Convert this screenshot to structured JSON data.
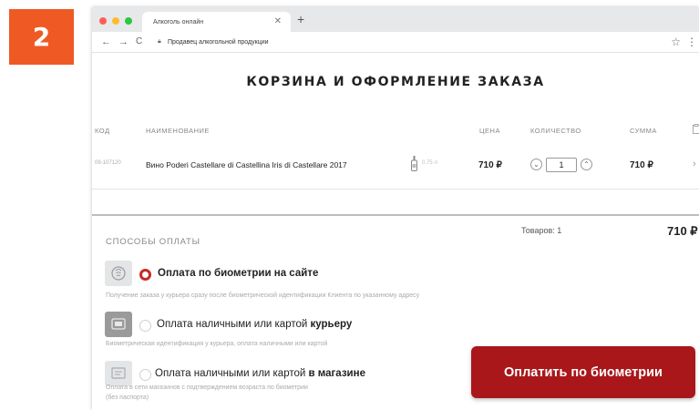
{
  "step_number": "2",
  "browser": {
    "tab_title": "Алкоголь онлайн",
    "address": "Продавец алкогольной продукции",
    "icons": [
      "close-icon",
      "plus-icon",
      "back-arrow-icon",
      "forward-arrow-icon",
      "reload-icon",
      "lock-icon",
      "star-icon",
      "more-vertical-icon"
    ]
  },
  "page": {
    "title": "КОРЗИНА И ОФОРМЛЕНИЕ ЗАКАЗА",
    "columns": {
      "code": "КОД",
      "name": "НАИМЕНОВАНИЕ",
      "price": "ЦЕНА",
      "quantity": "КОЛИЧЕСТВО",
      "sum": "СУММА"
    },
    "item": {
      "code": "09-107120",
      "name": "Вино Poderi Castellare di Castellina Iris di Castellare 2017",
      "volume": "0.75 л",
      "price": "710 ₽",
      "quantity": "1",
      "sum": "710 ₽"
    },
    "summary": {
      "goods_count": "Товаров: 1",
      "total": "710 ₽"
    },
    "payment": {
      "heading": "СПОСОБЫ ОПЛАТЫ",
      "options": [
        {
          "label": "Оплата по биометрии на сайте",
          "description": "Получение заказа у курьера сразу после биометрической идентификации Клиента по указанному адресу",
          "selected": true,
          "icon": "biometric-icon"
        },
        {
          "label_prefix": "Оплата наличными или картой ",
          "label_bold": "курьеру",
          "description": "Биометрическая идентификация у курьера, оплата наличными или картой",
          "selected": false,
          "icon": "courier-icon"
        },
        {
          "label_prefix": "Оплата наличными или картой ",
          "label_bold": "в магазине",
          "description_line1": "Оплата в сети магазинов с подтверждением возраста по биометрии",
          "description_line2": "(без паспорта)",
          "selected": false,
          "icon": "store-icon"
        }
      ],
      "button_label": "Оплатить по биометрии"
    }
  },
  "colors": {
    "badge": "#ef5a24",
    "primary_button": "#a9171a",
    "radio_selected": "#c62a26"
  }
}
